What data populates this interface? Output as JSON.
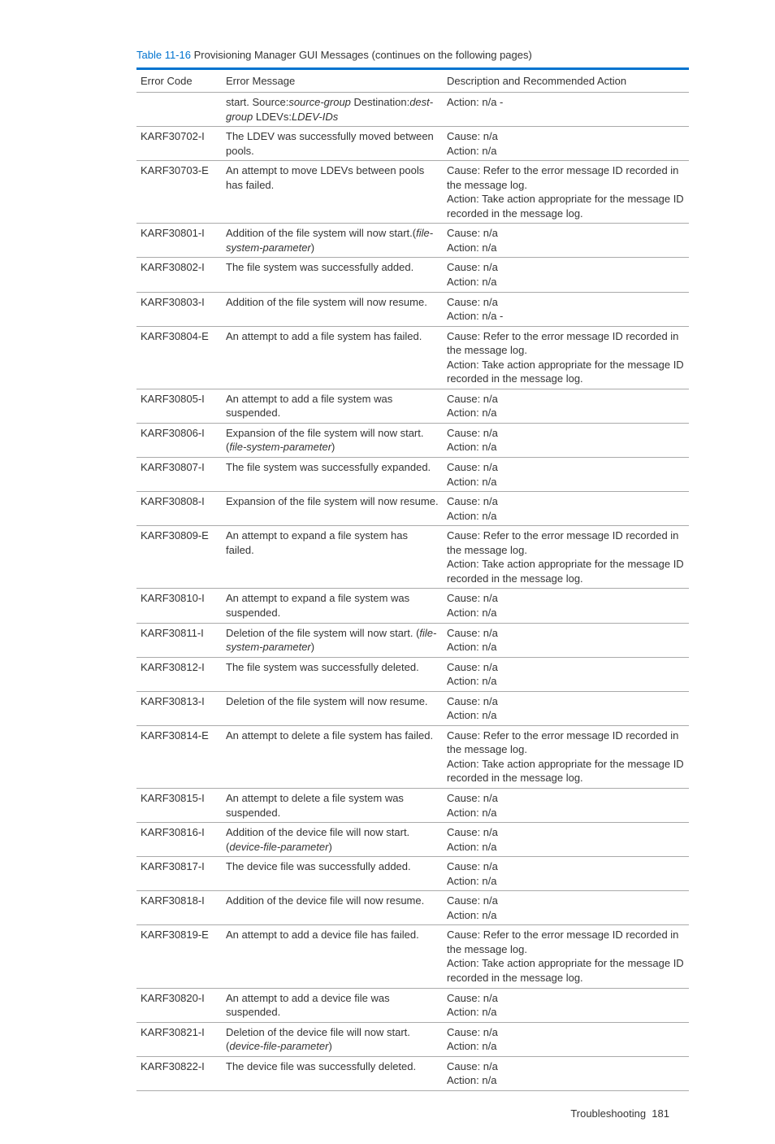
{
  "caption": {
    "label": "Table 11-16",
    "text": " Provisioning Manager GUI Messages (continues on the following pages)"
  },
  "headers": {
    "c1": "Error Code",
    "c2": "Error Message",
    "c3": "Description and Recommended Action"
  },
  "rows": [
    {
      "code": "",
      "msg": "start. Source:<em>source-group</em> Destination:<em>dest-group</em> LDEVs:<em>LDEV-IDs</em>",
      "desc": "Action: n/a -"
    },
    {
      "code": "KARF30702-I",
      "msg": "The LDEV was successfully moved between pools.",
      "desc": "Cause: n/a<br>Action: n/a"
    },
    {
      "code": "KARF30703-E",
      "msg": "An attempt to move LDEVs between pools has failed.",
      "desc": "Cause: Refer to the error message ID recorded in the message log.<br>Action: Take action appropriate for the message ID recorded in the message log."
    },
    {
      "code": "KARF30801-I",
      "msg": "Addition of the file system will now start.(<em>file-system-parameter</em>)",
      "desc": "Cause: n/a<br>Action: n/a"
    },
    {
      "code": "KARF30802-I",
      "msg": "The file system was successfully added.",
      "desc": "Cause: n/a<br>Action: n/a"
    },
    {
      "code": "KARF30803-I",
      "msg": "Addition of the file system will now resume.",
      "desc": "Cause: n/a<br>Action: n/a -"
    },
    {
      "code": "KARF30804-E",
      "msg": "An attempt to add a file system has failed.",
      "desc": "Cause: Refer to the error message ID recorded in the message log.<br>Action: Take action appropriate for the message ID recorded in the message log."
    },
    {
      "code": "KARF30805-I",
      "msg": "An attempt to add a file system was suspended.",
      "desc": "Cause: n/a<br>Action: n/a"
    },
    {
      "code": "KARF30806-I",
      "msg": "Expansion of the file system will now start. (<em>file-system-parameter</em>)",
      "desc": "Cause: n/a<br>Action: n/a"
    },
    {
      "code": "KARF30807-I",
      "msg": "The file system was successfully expanded.",
      "desc": "Cause: n/a<br>Action: n/a"
    },
    {
      "code": "KARF30808-I",
      "msg": "Expansion of the file system will now resume.",
      "desc": "Cause: n/a<br>Action: n/a"
    },
    {
      "code": "KARF30809-E",
      "msg": "An attempt to expand a file system has failed.",
      "desc": "Cause: Refer to the error message ID recorded in the message log.<br>Action: Take action appropriate for the message ID recorded in the message log."
    },
    {
      "code": "KARF30810-I",
      "msg": "An attempt to expand a file system was suspended.",
      "desc": "Cause: n/a<br>Action: n/a"
    },
    {
      "code": "KARF30811-I",
      "msg": "Deletion of the file system will now start. (<em>file-system-parameter</em>)",
      "desc": "Cause: n/a<br>Action: n/a"
    },
    {
      "code": "KARF30812-I",
      "msg": "The file system was successfully deleted.",
      "desc": "Cause: n/a<br>Action: n/a"
    },
    {
      "code": "KARF30813-I",
      "msg": "Deletion of the file system will now resume.",
      "desc": "Cause: n/a<br>Action: n/a"
    },
    {
      "code": "KARF30814-E",
      "msg": "An attempt to delete a file system has failed.",
      "desc": "Cause: Refer to the error message ID recorded in the message log.<br>Action: Take action appropriate for the message ID recorded in the message log."
    },
    {
      "code": "KARF30815-I",
      "msg": "An attempt to delete a file system was suspended.",
      "desc": "Cause: n/a<br>Action: n/a"
    },
    {
      "code": "KARF30816-I",
      "msg": "Addition of the device file will now start. (<em>device-file-parameter</em>)",
      "desc": "Cause: n/a<br>Action: n/a"
    },
    {
      "code": "KARF30817-I",
      "msg": "The device file was successfully added.",
      "desc": "Cause: n/a<br>Action: n/a"
    },
    {
      "code": "KARF30818-I",
      "msg": "Addition of the device file will now resume.",
      "desc": "Cause: n/a<br>Action: n/a"
    },
    {
      "code": "KARF30819-E",
      "msg": "An attempt to add a device file has failed.",
      "desc": "Cause: Refer to the error message ID recorded in the message log.<br>Action: Take action appropriate for the message ID recorded in the message log."
    },
    {
      "code": "KARF30820-I",
      "msg": "An attempt to add a device file was suspended.",
      "desc": "Cause: n/a<br>Action: n/a"
    },
    {
      "code": "KARF30821-I",
      "msg": "Deletion of the device file will now start. (<em>device-file-parameter</em>)",
      "desc": "Cause: n/a<br>Action: n/a"
    },
    {
      "code": "KARF30822-I",
      "msg": "The device file was successfully deleted.",
      "desc": "Cause: n/a<br>Action: n/a"
    }
  ],
  "footer": {
    "section": "Troubleshooting",
    "page": "181"
  }
}
